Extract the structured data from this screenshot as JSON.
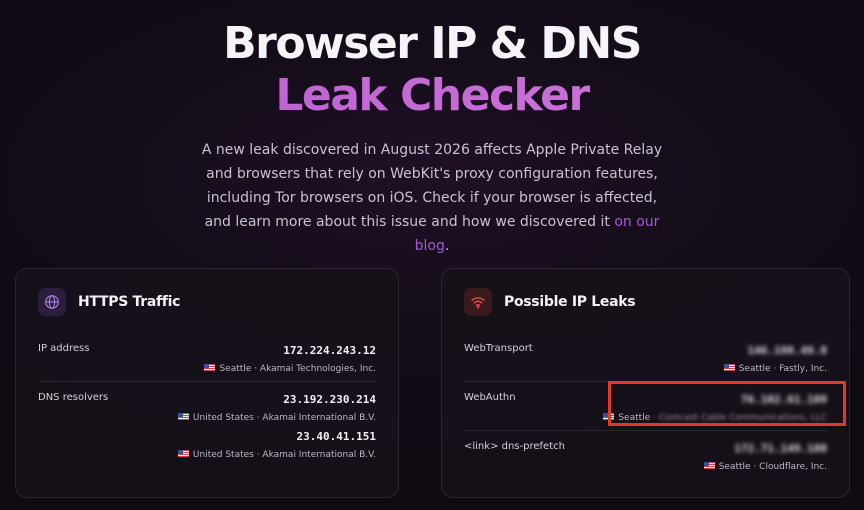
{
  "hero": {
    "title_line1": "Browser IP & DNS",
    "title_line2": "Leak Checker",
    "intro_text": "A new leak discovered in August 2026 affects Apple Private Relay and browsers that rely on WebKit's proxy configuration features, including Tor browsers on iOS. Check if your browser is affected, and learn more about this issue and how we discovered it ",
    "intro_link": "on our blog",
    "intro_end": "."
  },
  "https_card": {
    "icon": "globe-icon",
    "title": "HTTPS Traffic",
    "ip_label": "IP address",
    "ip_value": "172.224.243.12",
    "ip_location": "Seattle · Akamai Technologies, Inc.",
    "dns_label": "DNS resolvers",
    "dns": [
      {
        "ip": "23.192.230.214",
        "location": "United States · Akamai International B.V."
      },
      {
        "ip": "23.40.41.151",
        "location": "United States · Akamai International B.V."
      }
    ]
  },
  "leaks_card": {
    "icon": "wifi-icon",
    "title": "Possible IP Leaks",
    "rows": [
      {
        "label": "WebTransport",
        "ip": "146.198.49.8",
        "city": "Seattle",
        "org": "· Fastly, Inc."
      },
      {
        "label": "WebAuthn",
        "ip": "76.102.61.109",
        "city": "Seattle",
        "org": "· Comcast Cable Communications, LLC"
      },
      {
        "label": "<link> dns-prefetch",
        "ip": "172.71.149.188",
        "city": "Seattle",
        "org": "· Cloudflare, Inc."
      }
    ]
  },
  "colors": {
    "accent_purple": "#c46ad6",
    "link": "#a35ad6",
    "highlight_red": "#e0392b"
  }
}
